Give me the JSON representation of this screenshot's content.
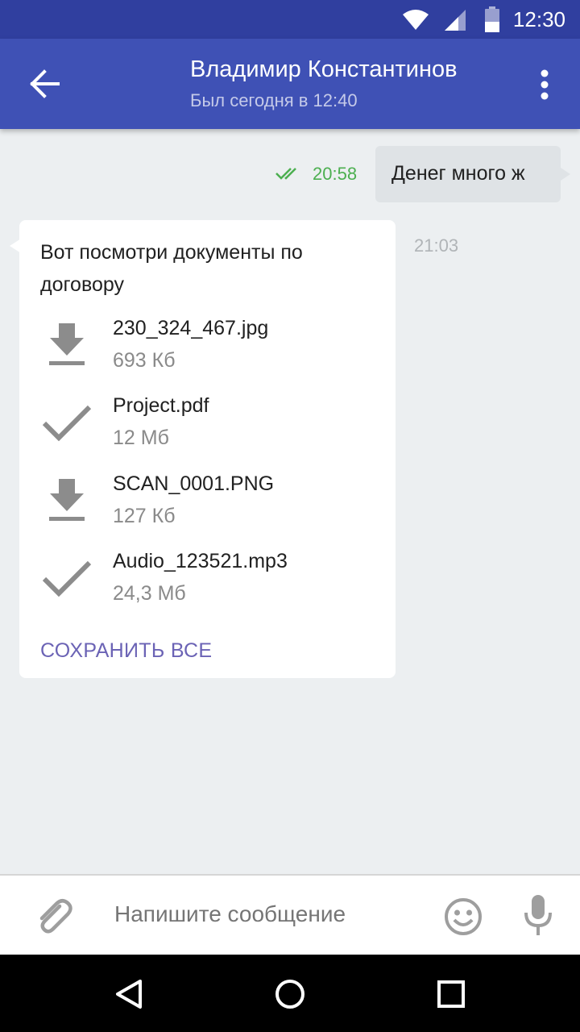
{
  "status_bar": {
    "time": "12:30",
    "icons": [
      "wifi-icon",
      "signal-icon",
      "battery-icon"
    ]
  },
  "header": {
    "back_icon": "arrow-left-icon",
    "contact_name": "Владимир Константинов",
    "last_seen": "Был сегодня в 12:40",
    "menu_icon": "more-vert-icon"
  },
  "messages": {
    "outgoing": {
      "text": "Денег много ж",
      "time": "20:58",
      "status_icon": "double-check-icon"
    },
    "incoming": {
      "text": "Вот посмотри документы по договору",
      "time": "21:03",
      "files": [
        {
          "name": "230_324_467.jpg",
          "size": "693 Кб",
          "icon": "download-icon"
        },
        {
          "name": "Project.pdf",
          "size": "12 Мб",
          "icon": "check-icon"
        },
        {
          "name": "SCAN_0001.PNG",
          "size": "127 Кб",
          "icon": "download-icon"
        },
        {
          "name": "Audio_123521.mp3",
          "size": "24,3 Мб",
          "icon": "check-icon"
        }
      ],
      "save_all_label": "СОХРАНИТЬ ВСЕ"
    }
  },
  "composer": {
    "placeholder": "Напишите сообщение",
    "attach_icon": "paperclip-icon",
    "emoji_icon": "emoji-icon",
    "mic_icon": "microphone-icon"
  },
  "nav_bar": {
    "icons": [
      "back-triangle-icon",
      "home-circle-icon",
      "recents-square-icon"
    ]
  },
  "colors": {
    "primary": "#3f51b5",
    "primary_dark": "#303f9f",
    "accent": "#6b63b5",
    "read_green": "#4caf50"
  }
}
